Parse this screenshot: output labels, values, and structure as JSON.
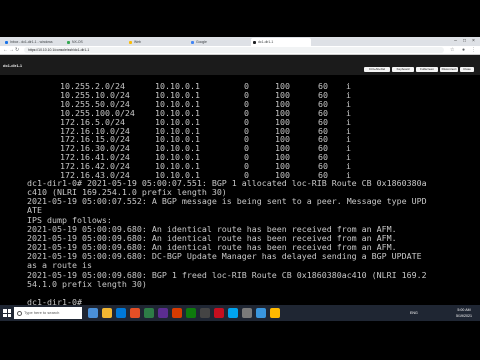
{
  "browser": {
    "tabs": [
      {
        "label": "Inbox - dc1-dir1-1 - windows",
        "color": "#1a73e8",
        "active": false
      },
      {
        "label": "NX-OS",
        "color": "#34a853",
        "active": false
      },
      {
        "label": "Web",
        "color": "#fbbc05",
        "active": false
      },
      {
        "label": "Google",
        "color": "#4285f4",
        "active": false
      },
      {
        "label": "dc1-dir1-1",
        "color": "#202124",
        "active": true
      }
    ],
    "url": "https://10.10.10.1/console/ssh/dc1-dir1-1"
  },
  "app": {
    "hostname": "dc1-dir1-1",
    "buttons": [
      "Ctrl+Alt+Del",
      "Keyboard",
      "Fullscreen",
      "Disconnect",
      "Close"
    ]
  },
  "terminal": {
    "routes": [
      {
        "prefix": "10.255.2.0/24",
        "next_hop": "10.10.0.1",
        "metric": "0",
        "locprf": "100",
        "path": "60",
        "origin": "i"
      },
      {
        "prefix": "10.255.10.0/24",
        "next_hop": "10.10.0.1",
        "metric": "0",
        "locprf": "100",
        "path": "60",
        "origin": "i"
      },
      {
        "prefix": "10.255.50.0/24",
        "next_hop": "10.10.0.1",
        "metric": "0",
        "locprf": "100",
        "path": "60",
        "origin": "i"
      },
      {
        "prefix": "10.255.100.0/24",
        "next_hop": "10.10.0.1",
        "metric": "0",
        "locprf": "100",
        "path": "60",
        "origin": "i"
      },
      {
        "prefix": "172.16.5.0/24",
        "next_hop": "10.10.0.1",
        "metric": "0",
        "locprf": "100",
        "path": "60",
        "origin": "i"
      },
      {
        "prefix": "172.16.10.0/24",
        "next_hop": "10.10.0.1",
        "metric": "0",
        "locprf": "100",
        "path": "60",
        "origin": "i"
      },
      {
        "prefix": "172.16.15.0/24",
        "next_hop": "10.10.0.1",
        "metric": "0",
        "locprf": "100",
        "path": "60",
        "origin": "i"
      },
      {
        "prefix": "172.16.30.0/24",
        "next_hop": "10.10.0.1",
        "metric": "0",
        "locprf": "100",
        "path": "60",
        "origin": "i"
      },
      {
        "prefix": "172.16.41.0/24",
        "next_hop": "10.10.0.1",
        "metric": "0",
        "locprf": "100",
        "path": "60",
        "origin": "i"
      },
      {
        "prefix": "172.16.42.0/24",
        "next_hop": "10.10.0.1",
        "metric": "0",
        "locprf": "100",
        "path": "60",
        "origin": "i"
      },
      {
        "prefix": "172.16.43.0/24",
        "next_hop": "10.10.0.1",
        "metric": "0",
        "locprf": "100",
        "path": "60",
        "origin": "i"
      }
    ],
    "log_lines": [
      "dc1-dir1-0# 2021-05-19 05:00:07.551: BGP 1 allocated loc-RIB Route CB 0x1860380a",
      "c410 (NLRI 169.254.1.0 prefix length 30)",
      "2021-05-19 05:00:07.552: A BGP message is being sent to a peer. Message type UPD",
      "ATE",
      "IPS dump follows:",
      "2021-05-19 05:00:09.680: An identical route has been received from an AFM.",
      "2021-05-19 05:00:09.680: An identical route has been received from an AFM.",
      "2021-05-19 05:00:09.680: An identical route has been received from an AFM.",
      "2021-05-19 05:00:09.680: DC-BGP Update Manager has delayed sending a BGP UPDATE",
      "as a route is",
      "2021-05-19 05:00:09.680: BGP 1 freed loc-RIB Route CB 0x1860380ac410 (NLRI 169.2",
      "54.1.0 prefix length 30)",
      "",
      "dc1-dir1-0#"
    ]
  },
  "taskbar": {
    "search_placeholder": "Type here to search",
    "icons": [
      "#4a90d9",
      "#f2b632",
      "#0078d7",
      "#e34f26",
      "#2d7d46",
      "#5c2d91",
      "#d83b01",
      "#0e7a0d",
      "#444444",
      "#c50f1f",
      "#00a4ef",
      "#7a7a7a",
      "#3a96dd",
      "#ffb900"
    ],
    "lang": "ENG",
    "time": "5:00 AM",
    "date": "5/19/2021"
  }
}
